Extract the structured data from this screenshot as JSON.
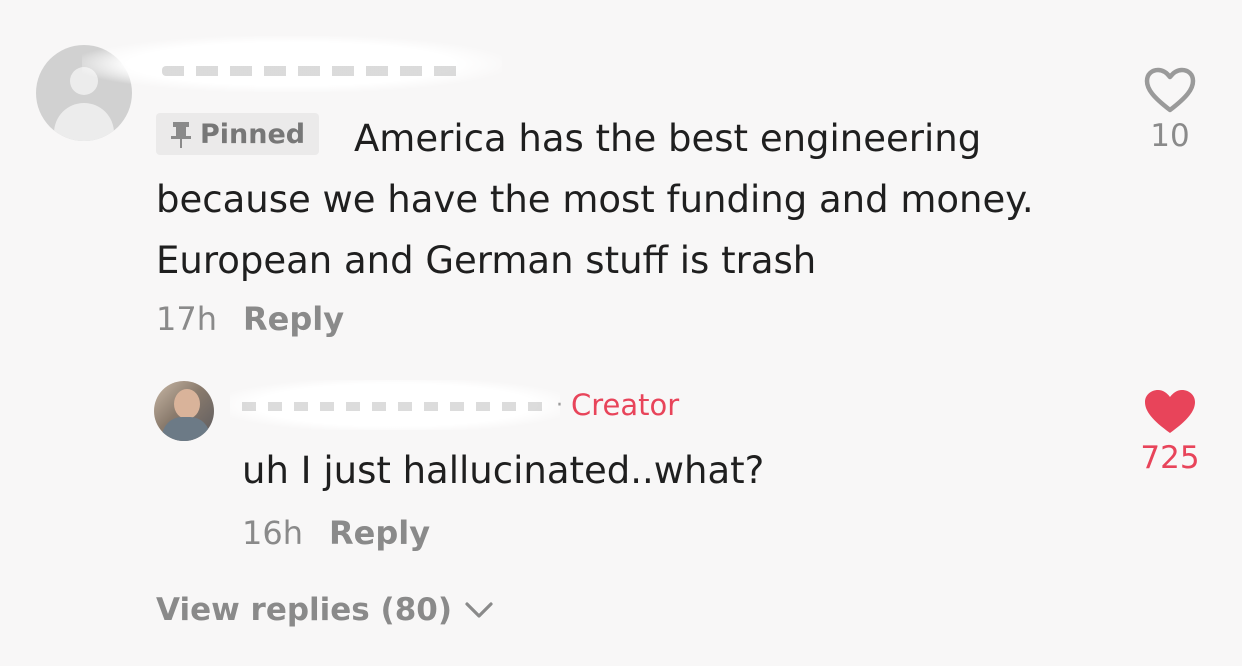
{
  "comment": {
    "pinned_label": "Pinned",
    "text": "America has the best engineering because we have the most funding and money. European and German stuff is trash",
    "time": "17h",
    "reply_label": "Reply",
    "likes": "10",
    "like_state": "not-liked"
  },
  "reply": {
    "creator_label": "Creator",
    "separator": "·",
    "text": "uh I just hallucinated..what?",
    "time": "16h",
    "reply_label": "Reply",
    "likes": "725",
    "like_state": "liked"
  },
  "view_replies_label": "View replies (80)",
  "icons": {
    "pin": "pin-icon",
    "heart_outline": "heart-outline-icon",
    "heart_filled": "heart-filled-icon",
    "chevron": "chevron-down-icon"
  },
  "colors": {
    "background": "#f8f7f7",
    "text": "#1f1f1f",
    "muted": "#8a8a8a",
    "accent": "#e8445a"
  }
}
